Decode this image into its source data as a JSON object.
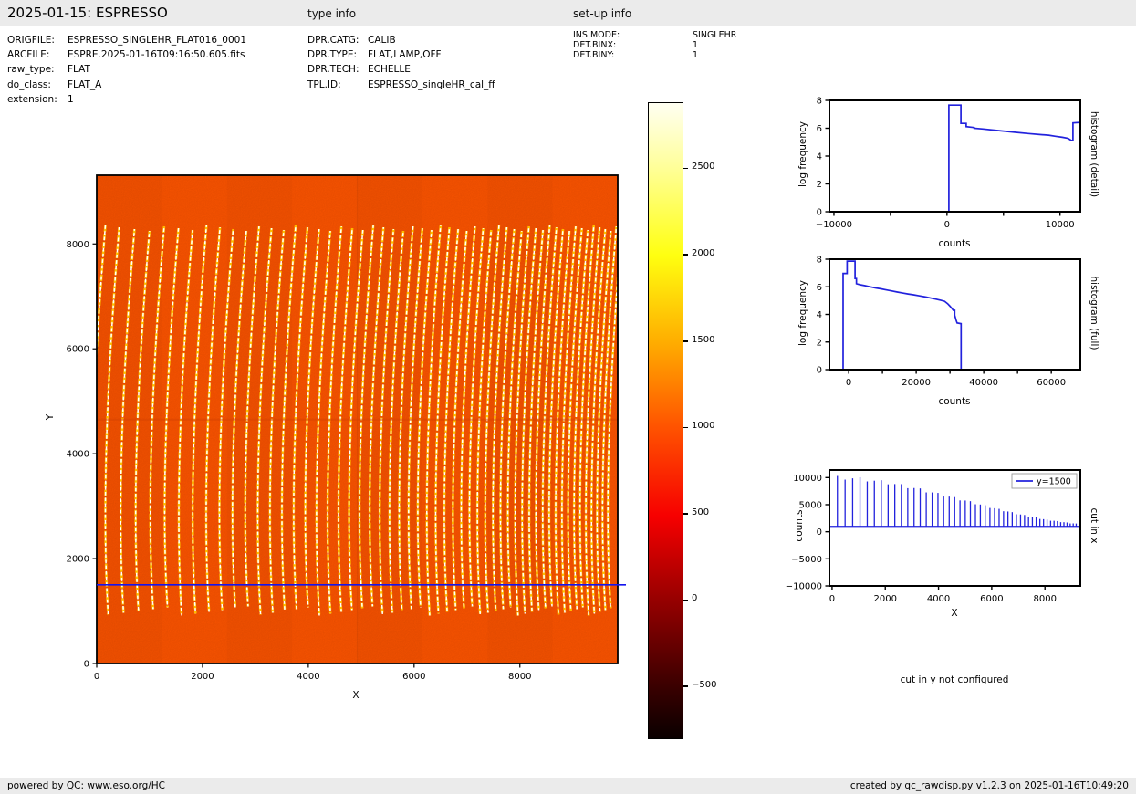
{
  "header": {
    "title": "2025-01-15: ESPRESSO",
    "type_info_title": "type info",
    "setup_info_title": "set-up info",
    "file_info": [
      {
        "label": "ORIGFILE:",
        "value": "ESPRESSO_SINGLEHR_FLAT016_0001"
      },
      {
        "label": "ARCFILE:",
        "value": "ESPRE.2025-01-16T09:16:50.605.fits"
      },
      {
        "label": "raw_type:",
        "value": "FLAT"
      },
      {
        "label": "do_class:",
        "value": "FLAT_A"
      },
      {
        "label": "extension:",
        "value": "1"
      }
    ],
    "type_info": [
      {
        "label": "DPR.CATG:",
        "value": "CALIB"
      },
      {
        "label": "DPR.TYPE:",
        "value": "FLAT,LAMP,OFF"
      },
      {
        "label": "DPR.TECH:",
        "value": "ECHELLE"
      },
      {
        "label": "TPL.ID:",
        "value": "ESPRESSO_singleHR_cal_ff"
      }
    ],
    "setup_info": [
      {
        "label": "INS.MODE:",
        "value": "SINGLEHR"
      },
      {
        "label": "DET.BINX:",
        "value": "1"
      },
      {
        "label": "DET.BINY:",
        "value": "1"
      }
    ]
  },
  "footer": {
    "left": "powered by QC: www.eso.org/HC",
    "right": "created by qc_rawdisp.py v1.2.3 on 2025-01-16T10:49:20"
  },
  "colors": {
    "curve_blue": "#2222dd",
    "cut_line_blue": "#1414ee",
    "image_background": "#ff5500",
    "stripe_halo_yellow": "#ffc400",
    "stripe_core_white": "#ffffff",
    "detector_gap_line": "#d94400",
    "bar_gray": "#ebebeb"
  },
  "chart_data": [
    {
      "id": "raw_image",
      "type": "heatmap",
      "title": "",
      "xlabel": "X",
      "ylabel": "Y",
      "xlim": [
        0,
        9850
      ],
      "ylim": [
        0,
        9310
      ],
      "x_ticks": [
        0,
        2000,
        4000,
        6000,
        8000
      ],
      "y_ticks": [
        0,
        2000,
        4000,
        6000,
        8000
      ],
      "description": "ESPRESSO raw FLAT frame: ~50 bright echelle order stripes on orange background (hot colormap), orders span Y~1000 to Y~8300, slightly curved, denser toward high X",
      "orders_model": {
        "first_x": 200,
        "initial_spacing": 295,
        "spacing_decay": 0.98,
        "max_x": 9790,
        "top_y": 8300,
        "bottom_y": 1000
      },
      "cut_line_y": 1500,
      "detector_gap_y": 4650
    },
    {
      "id": "colorbar",
      "type": "colorbar",
      "colormap": "hot",
      "vmin": -800,
      "vmax": 2880,
      "ticks": [
        2500,
        2000,
        1500,
        1000,
        500,
        0,
        -500
      ],
      "gradient_top_to_bottom": [
        {
          "pos": 0,
          "c": "#fffff2"
        },
        {
          "pos": 10,
          "c": "#ffff9a"
        },
        {
          "pos": 24,
          "c": "#ffff10"
        },
        {
          "pos": 37.5,
          "c": "#ffae00"
        },
        {
          "pos": 51,
          "c": "#ff5300"
        },
        {
          "pos": 65,
          "c": "#f70000"
        },
        {
          "pos": 78,
          "c": "#980000"
        },
        {
          "pos": 92,
          "c": "#390000"
        },
        {
          "pos": 100,
          "c": "#0a0000"
        }
      ]
    },
    {
      "id": "histogram_detail",
      "type": "line",
      "xlabel": "counts",
      "ylabel": "log frequency",
      "side_label": "histogram (detail)",
      "xlim": [
        -10400,
        11800
      ],
      "ylim": [
        0,
        8
      ],
      "x_ticks": [
        -10000,
        0,
        10000
      ],
      "x_minor_ticks": [
        -5000,
        5000
      ],
      "y_ticks": [
        0,
        2,
        4,
        6,
        8
      ],
      "points": [
        [
          -10400,
          0
        ],
        [
          170,
          0
        ],
        [
          170,
          7.66
        ],
        [
          1230,
          7.66
        ],
        [
          1230,
          6.35
        ],
        [
          1700,
          6.35
        ],
        [
          1700,
          6.12
        ],
        [
          2400,
          6.05
        ],
        [
          2400,
          6.0
        ],
        [
          3200,
          5.95
        ],
        [
          4200,
          5.86
        ],
        [
          5200,
          5.78
        ],
        [
          6200,
          5.7
        ],
        [
          7200,
          5.62
        ],
        [
          8200,
          5.55
        ],
        [
          9000,
          5.5
        ],
        [
          9600,
          5.42
        ],
        [
          10200,
          5.35
        ],
        [
          10700,
          5.28
        ],
        [
          11000,
          5.12
        ],
        [
          11150,
          5.12
        ],
        [
          11150,
          6.38
        ],
        [
          11800,
          6.42
        ]
      ]
    },
    {
      "id": "histogram_full",
      "type": "line",
      "xlabel": "counts",
      "ylabel": "log frequency",
      "side_label": "histogram (full)",
      "xlim": [
        -5700,
        68600
      ],
      "ylim": [
        0,
        8
      ],
      "x_ticks": [
        0,
        20000,
        40000,
        60000
      ],
      "x_minor_ticks": [
        10000,
        30000,
        50000
      ],
      "y_ticks": [
        0,
        2,
        4,
        6,
        8
      ],
      "points": [
        [
          -5700,
          0
        ],
        [
          -1650,
          0
        ],
        [
          -1650,
          6.97
        ],
        [
          -450,
          6.97
        ],
        [
          -450,
          7.86
        ],
        [
          1900,
          7.86
        ],
        [
          1900,
          6.6
        ],
        [
          2300,
          6.6
        ],
        [
          2300,
          6.22
        ],
        [
          3400,
          6.15
        ],
        [
          4800,
          6.08
        ],
        [
          6400,
          6.0
        ],
        [
          8000,
          5.92
        ],
        [
          9600,
          5.85
        ],
        [
          11200,
          5.77
        ],
        [
          12800,
          5.7
        ],
        [
          14400,
          5.62
        ],
        [
          16000,
          5.55
        ],
        [
          17600,
          5.48
        ],
        [
          19200,
          5.42
        ],
        [
          20800,
          5.35
        ],
        [
          22400,
          5.28
        ],
        [
          24000,
          5.2
        ],
        [
          25600,
          5.12
        ],
        [
          27200,
          5.03
        ],
        [
          28400,
          4.95
        ],
        [
          29300,
          4.78
        ],
        [
          29900,
          4.62
        ],
        [
          30500,
          4.45
        ],
        [
          31000,
          4.3
        ],
        [
          31400,
          4.3
        ],
        [
          31400,
          3.95
        ],
        [
          31800,
          3.6
        ],
        [
          32100,
          3.38
        ],
        [
          33300,
          3.33
        ],
        [
          33300,
          0
        ]
      ]
    },
    {
      "id": "cut_in_x",
      "type": "line",
      "xlabel": "X",
      "ylabel": "counts",
      "side_label": "cut in x",
      "legend": "y=1500",
      "xlim": [
        -100,
        9330
      ],
      "ylim": [
        -10000,
        11400
      ],
      "x_ticks": [
        0,
        2000,
        4000,
        6000,
        8000
      ],
      "y_ticks": [
        10000,
        5000,
        0,
        -5000,
        -10000
      ],
      "baseline": 1000,
      "peak_envelope": [
        [
          200,
          10000
        ],
        [
          1000,
          9800
        ],
        [
          2000,
          9150
        ],
        [
          3000,
          8150
        ],
        [
          4000,
          6950
        ],
        [
          5000,
          5750
        ],
        [
          6000,
          4450
        ],
        [
          7000,
          3250
        ],
        [
          8000,
          2250
        ],
        [
          9000,
          1550
        ],
        [
          9800,
          1250
        ]
      ]
    },
    {
      "id": "cut_in_y",
      "type": "note",
      "text": "cut in y not configured"
    }
  ]
}
